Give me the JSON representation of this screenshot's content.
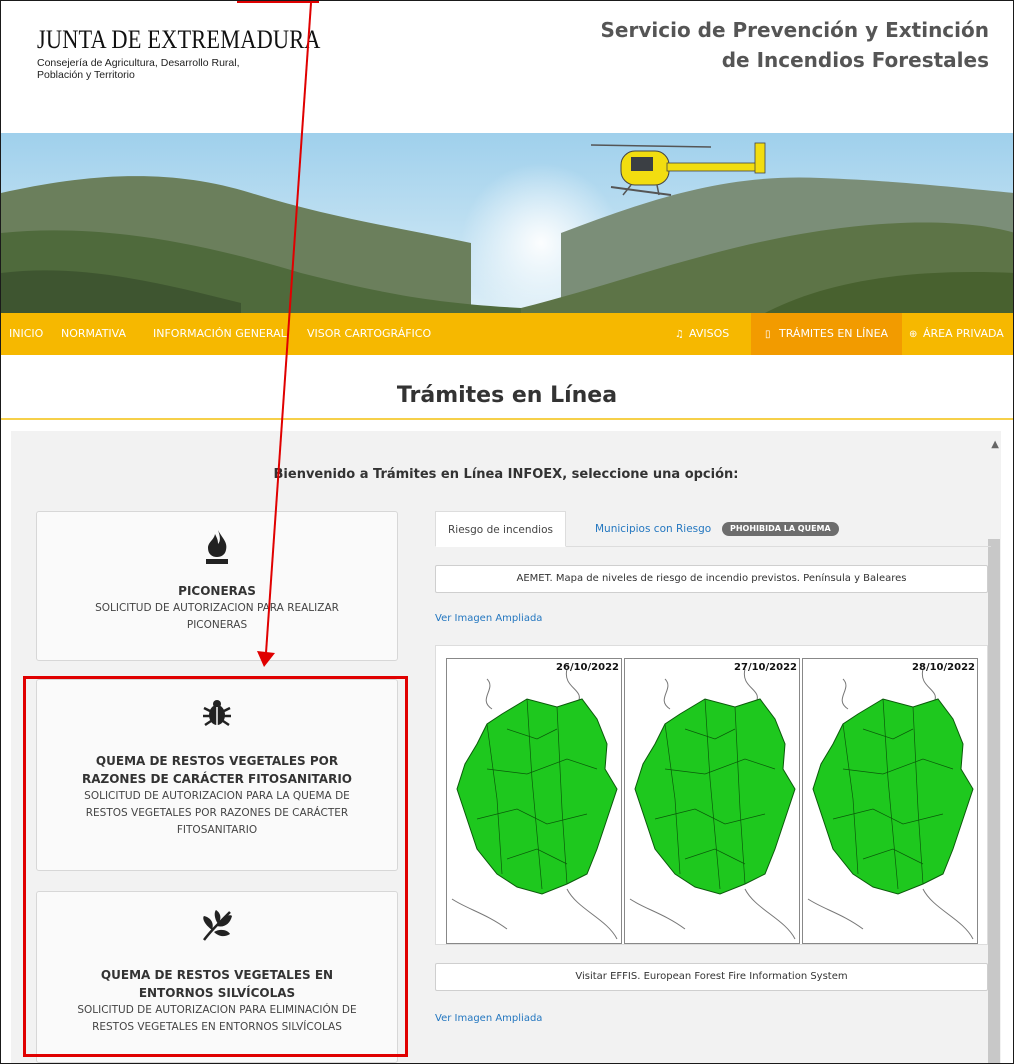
{
  "header": {
    "logo_title": "JUNTA DE EXTREMADURA",
    "logo_sub_line1": "Consejería de Agricultura, Desarrollo Rural,",
    "logo_sub_line2": "Población y Territorio",
    "site_title_line1": "Servicio de Prevención y Extinción",
    "site_title_line2": "de Incendios Forestales"
  },
  "nav": {
    "inicio": "INICIO",
    "normativa": "NORMATIVA",
    "informacion": "INFORMACIÓN GENERAL",
    "visor": "VISOR CARTOGRÁFICO",
    "avisos": "AVISOS",
    "tramites": "TRÁMITES EN LÍNEA",
    "area_privada": "ÁREA PRIVADA",
    "accent_color": "#f6b800",
    "active_color": "#f29b00"
  },
  "page_title": "Trámites en Línea",
  "welcome": "Bienvenido a Trámites en Línea INFOEX, seleccione una opción:",
  "cards": [
    {
      "icon": "fire-icon",
      "title": "PICONERAS",
      "desc_line1": "SOLICITUD DE AUTORIZACION PARA REALIZAR",
      "desc_line2": "PICONERAS"
    },
    {
      "icon": "bug-icon",
      "title_line1": "QUEMA DE RESTOS VEGETALES POR",
      "title_line2": "RAZONES DE CARÁCTER FITOSANITARIO",
      "desc_line1": "SOLICITUD DE AUTORIZACION PARA LA QUEMA DE",
      "desc_line2": "RESTOS VEGETALES POR RAZONES DE CARÁCTER",
      "desc_line3": "FITOSANITARIO"
    },
    {
      "icon": "leaf-icon",
      "title_line1": "QUEMA DE RESTOS VEGETALES EN",
      "title_line2": "ENTORNOS SILVÍCOLAS",
      "desc_line1": "SOLICITUD DE AUTORIZACION PARA ELIMINACIÓN DE",
      "desc_line2": "RESTOS VEGETALES EN ENTORNOS SILVÍCOLAS"
    }
  ],
  "tabs": {
    "riesgo": "Riesgo de incendios",
    "municipios": "Municipios con Riesgo",
    "badge": "PHOHIBIDA LA QUEMA"
  },
  "aemet_label": "AEMET. Mapa de niveles de riesgo de incendio previstos. Península y Baleares",
  "ver_imagen_1": "Ver Imagen Ampliada",
  "map_dates": [
    "26/10/2022",
    "27/10/2022",
    "28/10/2022"
  ],
  "map_color": "#1ec81e",
  "effis_label": "Visitar EFFIS. European Forest Fire Information System",
  "ver_imagen_2": "Ver Imagen Ampliada",
  "highlight_color": "#e00000"
}
